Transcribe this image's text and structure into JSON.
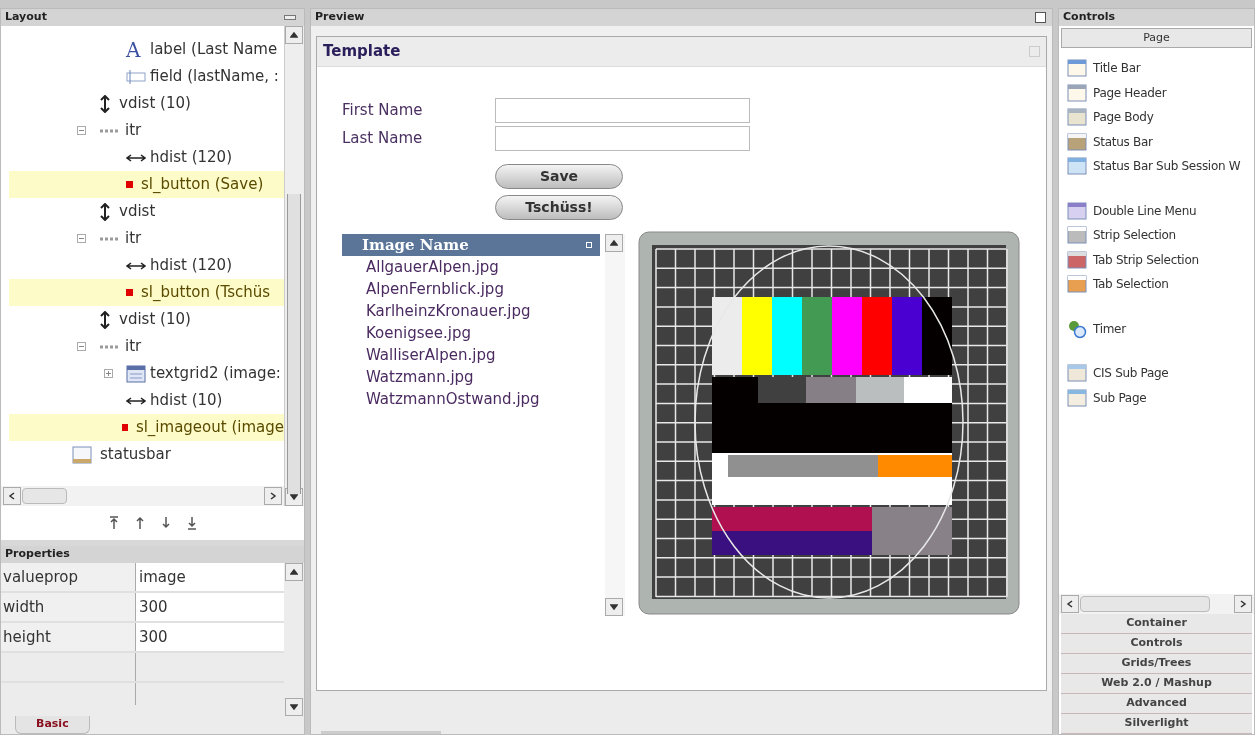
{
  "layout_panel": {
    "title": "Layout",
    "tree": [
      {
        "children": [
          {
            "children": [
              {
                "label": "label (Last Name",
                "kind": "label",
                "glyph": "A",
                "highlighted": false
              },
              {
                "label": "field (lastName, :",
                "kind": "field",
                "highlighted": false
              }
            ]
          },
          {
            "label": "vdist (10)",
            "kind": "vdist",
            "highlighted": false
          },
          {
            "label": "itr",
            "kind": "itr",
            "highlighted": false,
            "expanded": true,
            "children": [
              {
                "label": "hdist (120)",
                "kind": "hdist",
                "highlighted": false
              },
              {
                "label": "sl_button (Save)",
                "kind": "component",
                "highlighted": true
              }
            ]
          },
          {
            "label": "vdist",
            "kind": "vdist",
            "highlighted": false
          },
          {
            "label": "itr",
            "kind": "itr",
            "highlighted": false,
            "expanded": true,
            "children": [
              {
                "label": "hdist (120)",
                "kind": "hdist",
                "highlighted": false
              },
              {
                "label": "sl_button (Tschüs",
                "kind": "component",
                "highlighted": true
              }
            ]
          },
          {
            "label": "vdist (10)",
            "kind": "vdist",
            "highlighted": false
          },
          {
            "label": "itr",
            "kind": "itr",
            "highlighted": false,
            "expanded": true,
            "children": [
              {
                "label": "textgrid2 (image:",
                "kind": "grid",
                "highlighted": false,
                "expanded": false
              },
              {
                "label": "hdist (10)",
                "kind": "hdist",
                "highlighted": false
              },
              {
                "label": "sl_imageout (image",
                "kind": "component",
                "highlighted": true
              }
            ]
          }
        ]
      },
      {
        "label": "statusbar",
        "kind": "statusbar",
        "highlighted": false
      }
    ]
  },
  "properties_panel": {
    "title": "Properties",
    "rows": [
      {
        "name": "valueprop",
        "value": "image"
      },
      {
        "name": "width",
        "value": "300"
      },
      {
        "name": "height",
        "value": "300"
      }
    ],
    "tab": {
      "label": "Basic",
      "selected": true
    }
  },
  "preview": {
    "title": "Preview",
    "window_title": "Template",
    "fields": [
      {
        "label": "First Name"
      },
      {
        "label": "Last Name"
      }
    ],
    "buttons": [
      "Save",
      "Tschüss!"
    ],
    "grid": {
      "column": "Image Name",
      "rows": [
        "AllgauerAlpen.jpg",
        "AlpenFernblick.jpg",
        "KarlheinzKronauer.jpg",
        "Koenigsee.jpg",
        "WalliserAlpen.jpg",
        "Watzmann.jpg",
        "WatzmannOstwand.jpg"
      ]
    }
  },
  "controls_panel": {
    "title": "Controls",
    "open_section": "Page",
    "groups": [
      [
        {
          "label": "Title Bar",
          "kind": "titlebar"
        },
        {
          "label": "Page Header",
          "kind": "header"
        },
        {
          "label": "Page Body",
          "kind": "body"
        },
        {
          "label": "Status Bar",
          "kind": "statusbar"
        },
        {
          "label": "Status Bar Sub Session W",
          "kind": "subsession"
        }
      ],
      [
        {
          "label": "Double Line Menu",
          "kind": "menu"
        },
        {
          "label": "Strip Selection",
          "kind": "strip"
        },
        {
          "label": "Tab Strip Selection",
          "kind": "tabstrip"
        },
        {
          "label": "Tab Selection",
          "kind": "tab"
        }
      ],
      [
        {
          "label": "Timer",
          "kind": "timer"
        }
      ],
      [
        {
          "label": "CIS Sub Page",
          "kind": "cispage"
        },
        {
          "label": "Sub Page",
          "kind": "subpage"
        }
      ]
    ],
    "sections": [
      "Container",
      "Controls",
      "Grids/Trees",
      "Web 2.0 / Mashup",
      "Advanced",
      "Silverlight"
    ]
  }
}
